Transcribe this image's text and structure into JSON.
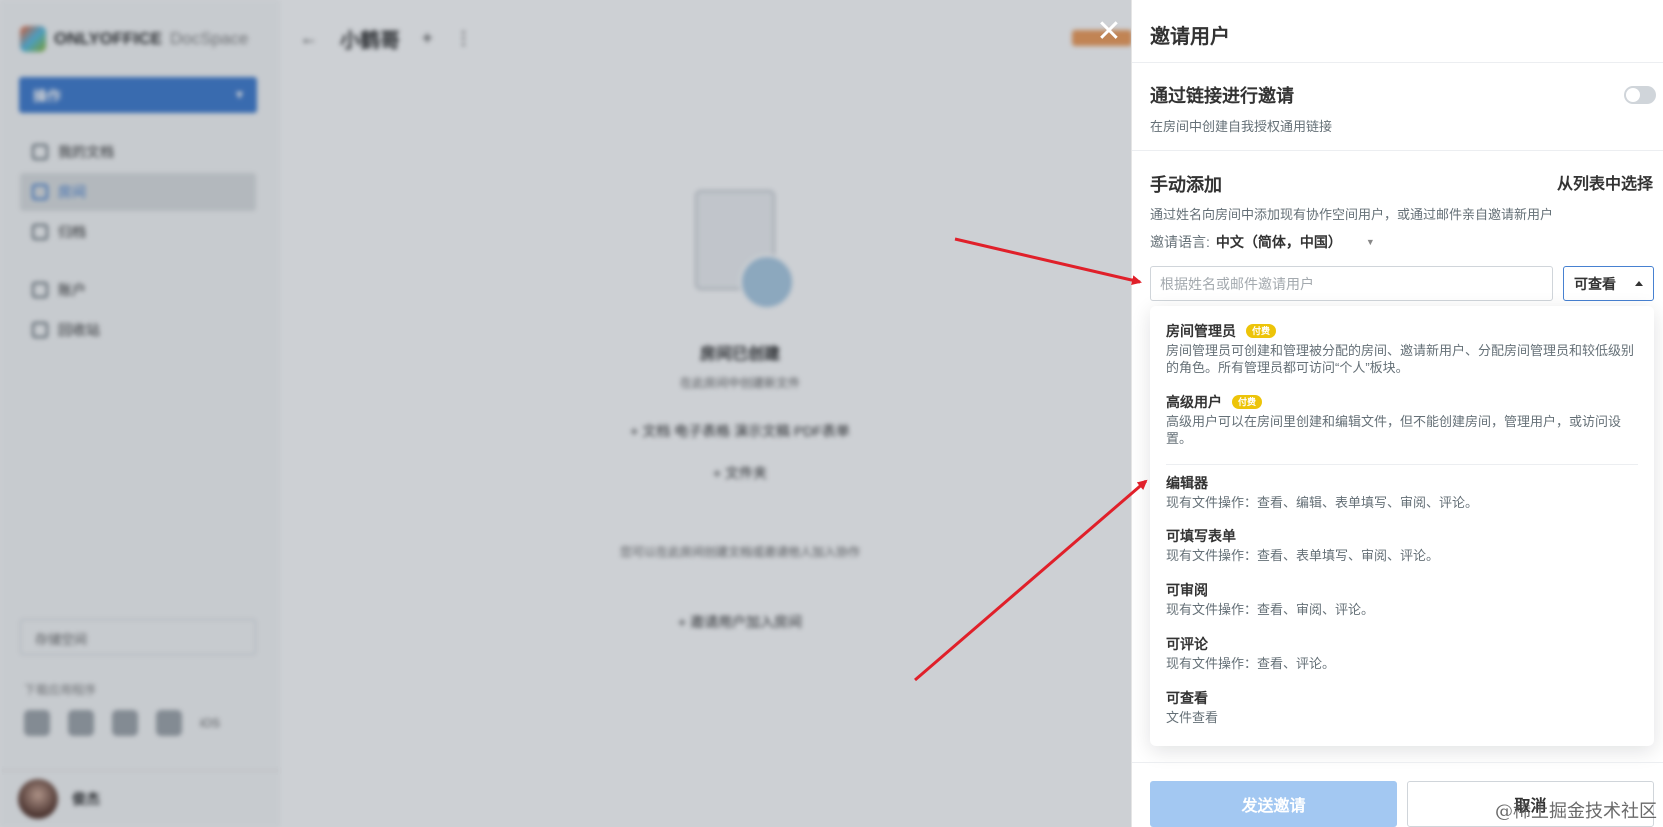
{
  "background_app": {
    "logo_text": "ONLYOFFICE",
    "logo_sub": "DocSpace",
    "actions_label": "操作",
    "sidebar_items": [
      "我的文档",
      "房间",
      "归档",
      "账户",
      "回收站"
    ],
    "bottom_box": "存储空间",
    "apps_label": "下载应用程序",
    "apps_extra": "iOS",
    "user_name": "俊杰",
    "room_title": "小鹤哥",
    "empty_title": "房间已创建",
    "empty_sub": "在此房间中创建新文件",
    "empty_links": "+ 文档   电子表格   演示文稿   PDF表单",
    "empty_links2": "+ 文件夹",
    "empty_desc": "您可以在此房间创建文档或邀请他人加入协作",
    "empty_add": "+ 邀请用户加入房间"
  },
  "panel": {
    "title": "邀请用户",
    "close_label": "✕",
    "link_section": {
      "title": "通过链接进行邀请",
      "desc": "在房间中创建自我授权通用链接",
      "enabled": false
    },
    "manual_section": {
      "title": "手动添加",
      "select_from_list": "从列表中选择",
      "desc": "通过姓名向房间中添加现有协作空间用户，或通过邮件亲自邀请新用户",
      "language_label": "邀请语言:",
      "language_value": "中文（简体，中国）",
      "search_placeholder": "根据姓名或邮件邀请用户",
      "role_selected": "可查看"
    },
    "role_options": [
      {
        "title": "房间管理员",
        "badge": "付费",
        "desc": "房间管理员可创建和管理被分配的房间、邀请新用户、分配房间管理员和较低级别的角色。所有管理员都可访问“个人”板块。"
      },
      {
        "title": "高级用户",
        "badge": "付费",
        "desc": "高级用户可以在房间里创建和编辑文件，但不能创建房间，管理用户，或访问设置。"
      },
      {
        "title": "编辑器",
        "desc": "现有文件操作：查看、编辑、表单填写、审阅、评论。"
      },
      {
        "title": "可填写表单",
        "desc": "现有文件操作：查看、表单填写、审阅、评论。"
      },
      {
        "title": "可审阅",
        "desc": "现有文件操作：查看、审阅、评论。"
      },
      {
        "title": "可评论",
        "desc": "现有文件操作：查看、评论。"
      },
      {
        "title": "可查看",
        "desc": "文件查看"
      }
    ],
    "send_button": "发送邀请",
    "cancel_button": "取消"
  },
  "watermark": "@稀土掘金技术社区",
  "colors": {
    "accent": "#4781d1",
    "send_disabled": "#a3c8f2",
    "badge": "#edc409",
    "annotation_arrow": "#e0202a"
  }
}
